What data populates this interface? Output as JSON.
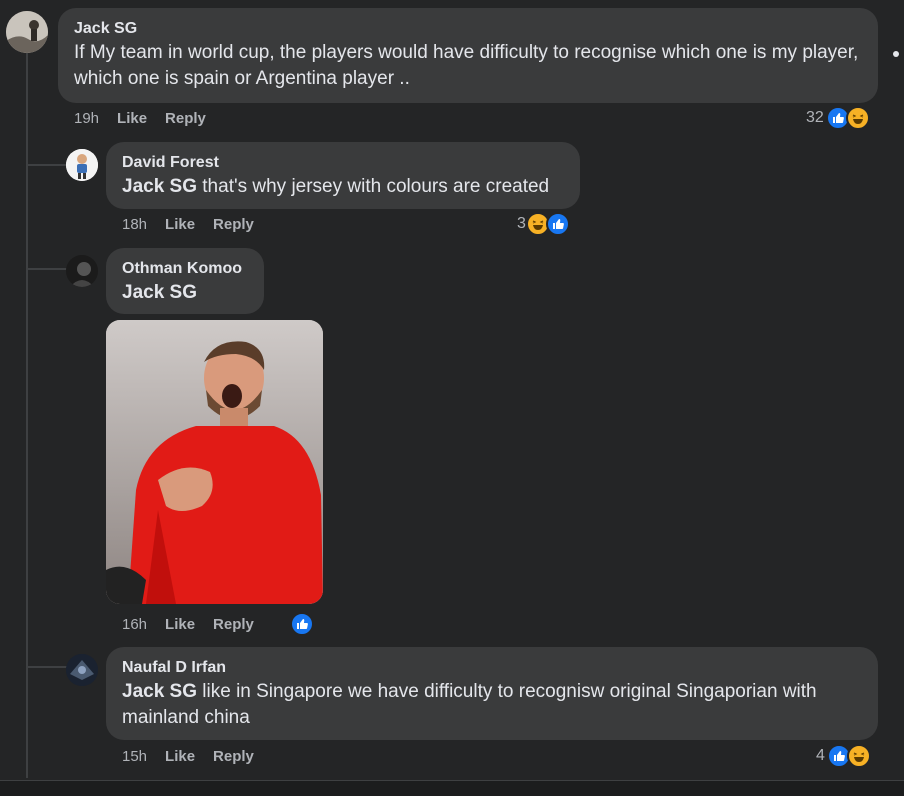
{
  "comments": [
    {
      "author": "Jack SG",
      "text": "If My team in world cup, the players would have difficulty to recognise which one is my player, which one is spain or Argentina player ..",
      "time": "19h",
      "like": "Like",
      "reply": "Reply",
      "reaction_count": "32",
      "reactions": [
        "like",
        "haha"
      ]
    },
    {
      "author": "David Forest",
      "tag": "Jack SG",
      "text": " that's why jersey with colours are created",
      "time": "18h",
      "like": "Like",
      "reply": "Reply",
      "reaction_count": "3",
      "reactions": [
        "haha",
        "like"
      ]
    },
    {
      "author": "Othman Komoo",
      "tag": "Jack SG",
      "time": "16h",
      "like": "Like",
      "reply": "Reply",
      "reactions": [
        "like"
      ]
    },
    {
      "author": "Naufal D Irfan",
      "tag": "Jack SG",
      "text": " like in Singapore we have difficulty to recognisw original Singaporian with mainland china",
      "time": "15h",
      "like": "Like",
      "reply": "Reply",
      "reaction_count": "4",
      "reactions": [
        "like",
        "haha"
      ]
    }
  ],
  "colors": {
    "background": "#242526",
    "bubble": "#3a3b3c",
    "text": "#e4e6eb",
    "muted": "#b0b3b8",
    "like_blue": "#1877f2",
    "haha_yellow": "#f7b125"
  },
  "icons": {
    "like": "thumbs-up-icon",
    "haha": "laughing-face-icon",
    "more": "more-options-icon"
  }
}
